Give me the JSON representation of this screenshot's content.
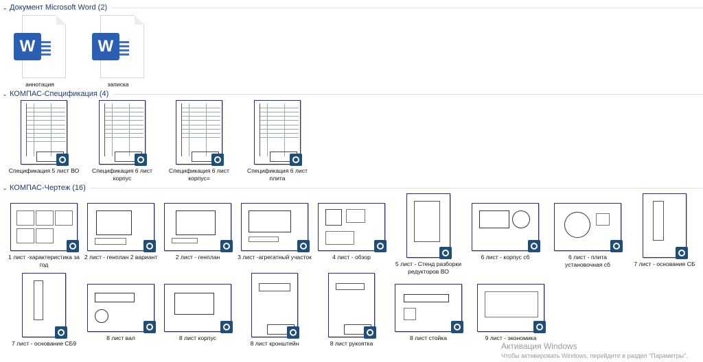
{
  "groups": {
    "word": {
      "title": "Документ Microsoft Word (2)",
      "items": [
        "аннотация",
        "записка"
      ]
    },
    "spec": {
      "title": "КОМПАС-Спецификация (4)",
      "items": [
        "Спецификация 5 лист ВО",
        "Спецификация 6 лист корпус",
        "Спецификация 6 лист корпус=",
        "Спецификация 6 лист плита"
      ]
    },
    "draw": {
      "title": "КОМПАС-Чертеж (16)",
      "items": [
        "1 лист -характеристика за год",
        "2 лист - генплан 2 вариант",
        "2 лист - генплан",
        "3 лист -агрегатный участок",
        "4 лист - обзор",
        "5 лист - Стенд разборки редукторов ВО",
        "6 лист - корпус сб",
        "6 лист - плита установочная сб",
        "7 лист - основание СБ",
        "7 лист - основание СБ9",
        "8 лист вал",
        "8 лист корпус",
        "8 лист кронштейн",
        "8 лист рукоятка",
        "8 лист стойка",
        "9 лист - экономика"
      ]
    }
  },
  "watermark": {
    "title": "Активация Windows",
    "subtitle": "Чтобы активировать Windows, перейдите в раздел \"Параметры\"."
  },
  "icons": {
    "word": "word-icon",
    "kompas": "kompas-badge-icon",
    "chevron": "chevron-down-icon"
  },
  "colors": {
    "kompas_badge": "#1f4e79",
    "word_blue": "#2b5fb4",
    "header_text": "#1e3a6e"
  }
}
